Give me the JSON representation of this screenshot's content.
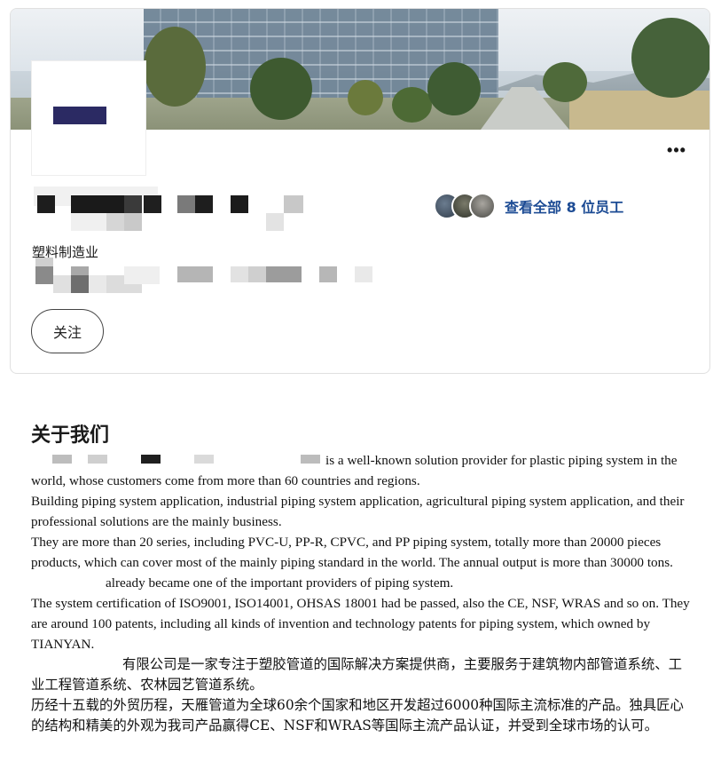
{
  "company": {
    "industry": "塑料制造业",
    "more_menu_label": "•••",
    "follow_label": "关注",
    "employees_link": "查看全部 8 位员工"
  },
  "about": {
    "heading": "关于我们",
    "paragraphs": {
      "p1_tail": "is a well-known solution provider for plastic piping system in the world, whose customers come from more than 60 countries and regions.",
      "p2": "Building piping system application, industrial piping system application, agricultural piping system application, and their professional solutions are the mainly business.",
      "p3_head": "They are more than 20 series, including PVC-U, PP-R, CPVC, and PP piping system, totally more than 20000 pieces products, which can cover most of the mainly piping standard in the world. The annual output is more than 30000 tons.",
      "p3_tail": "already became one of the important providers of piping system.",
      "p4": "The system certification of ISO9001, ISO14001, OHSAS 18001 had be passed, also the CE, NSF, WRAS and so on. They are around 100 patents, including all kinds of invention and technology patents for piping system, which owned by TIANYAN.",
      "cn1_tail": "有限公司是一家专注于塑胶管道的国际解决方案提供商，主要服务于建筑物内部管道系统、工业工程管道系统、农林园艺管道系统。",
      "cn2": "历经十五载的外贸历程，天雁管道为全球60余个国家和地区开发超过6000种国际主流标准的产品。独具匠心的结构和精美的外观为我司产品赢得CE、NSF和WRAS等国际主流产品认证，并受到全球市场的认可。"
    }
  },
  "colors": {
    "link": "#1c4b94",
    "logo_mark": "#2b2a63",
    "card_border": "#e0e0e0"
  }
}
